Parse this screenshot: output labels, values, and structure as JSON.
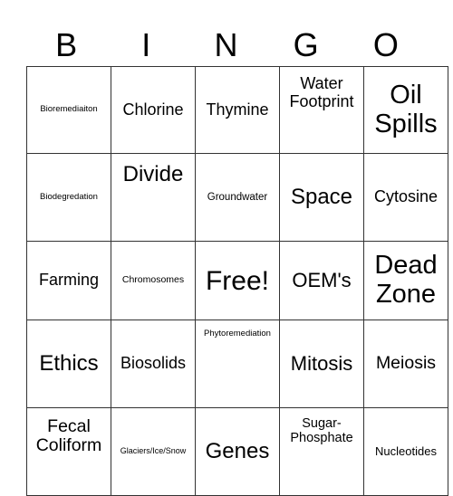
{
  "header": [
    "B",
    "I",
    "N",
    "G",
    "O"
  ],
  "rows": [
    [
      "Bioremediaiton",
      "Chlorine",
      "Thymine",
      "Water Footprint",
      "Oil Spills"
    ],
    [
      "Biodegredation",
      "Divide",
      "Groundwater",
      "Space",
      "Cytosine"
    ],
    [
      "Farming",
      "Chromosomes",
      "Free!",
      "OEM's",
      "Dead Zone"
    ],
    [
      "Ethics",
      "Biosolids",
      "Phytoremediation",
      "Mitosis",
      "Meiosis"
    ],
    [
      "Fecal Coliform",
      "Glaciers/Ice/Snow",
      "Genes",
      "Sugar-Phosphate",
      "Nucleotides"
    ]
  ]
}
